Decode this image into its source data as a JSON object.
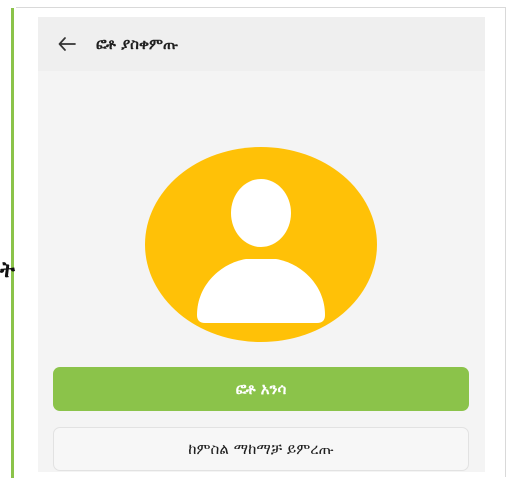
{
  "header": {
    "back_icon": "arrow-left-icon",
    "title": "ፎቶ ያስቀምጡ"
  },
  "avatar": {
    "icon": "person-icon",
    "background_color": "#ffc107"
  },
  "buttons": {
    "take_photo_label": "ፎቶ አንሳ",
    "pick_gallery_label": "ከምስል ማከማቻ ይምረጡ"
  },
  "edge": {
    "cut_glyph": "ት"
  },
  "colors": {
    "accent_green": "#8bc34a",
    "avatar_yellow": "#ffc107"
  }
}
